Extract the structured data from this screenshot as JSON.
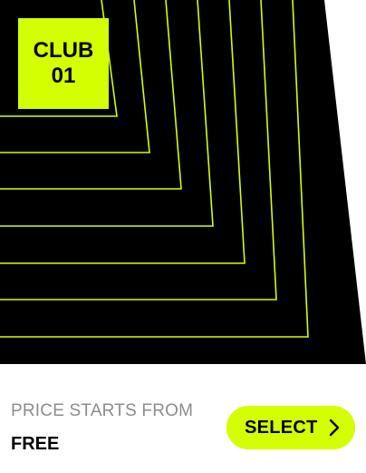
{
  "theme": {
    "accent": "#D4FF00",
    "background": "#000000",
    "muted_text": "#8D8D8D",
    "text": "#000000"
  },
  "hero": {
    "badge_line1": "CLUB",
    "badge_line2": "01",
    "pattern": "nested-corner-lines"
  },
  "pricing": {
    "label": "PRICE STARTS FROM",
    "value": "FREE"
  },
  "actions": {
    "select_label": "SELECT",
    "select_icon": "chevron-right-icon"
  }
}
